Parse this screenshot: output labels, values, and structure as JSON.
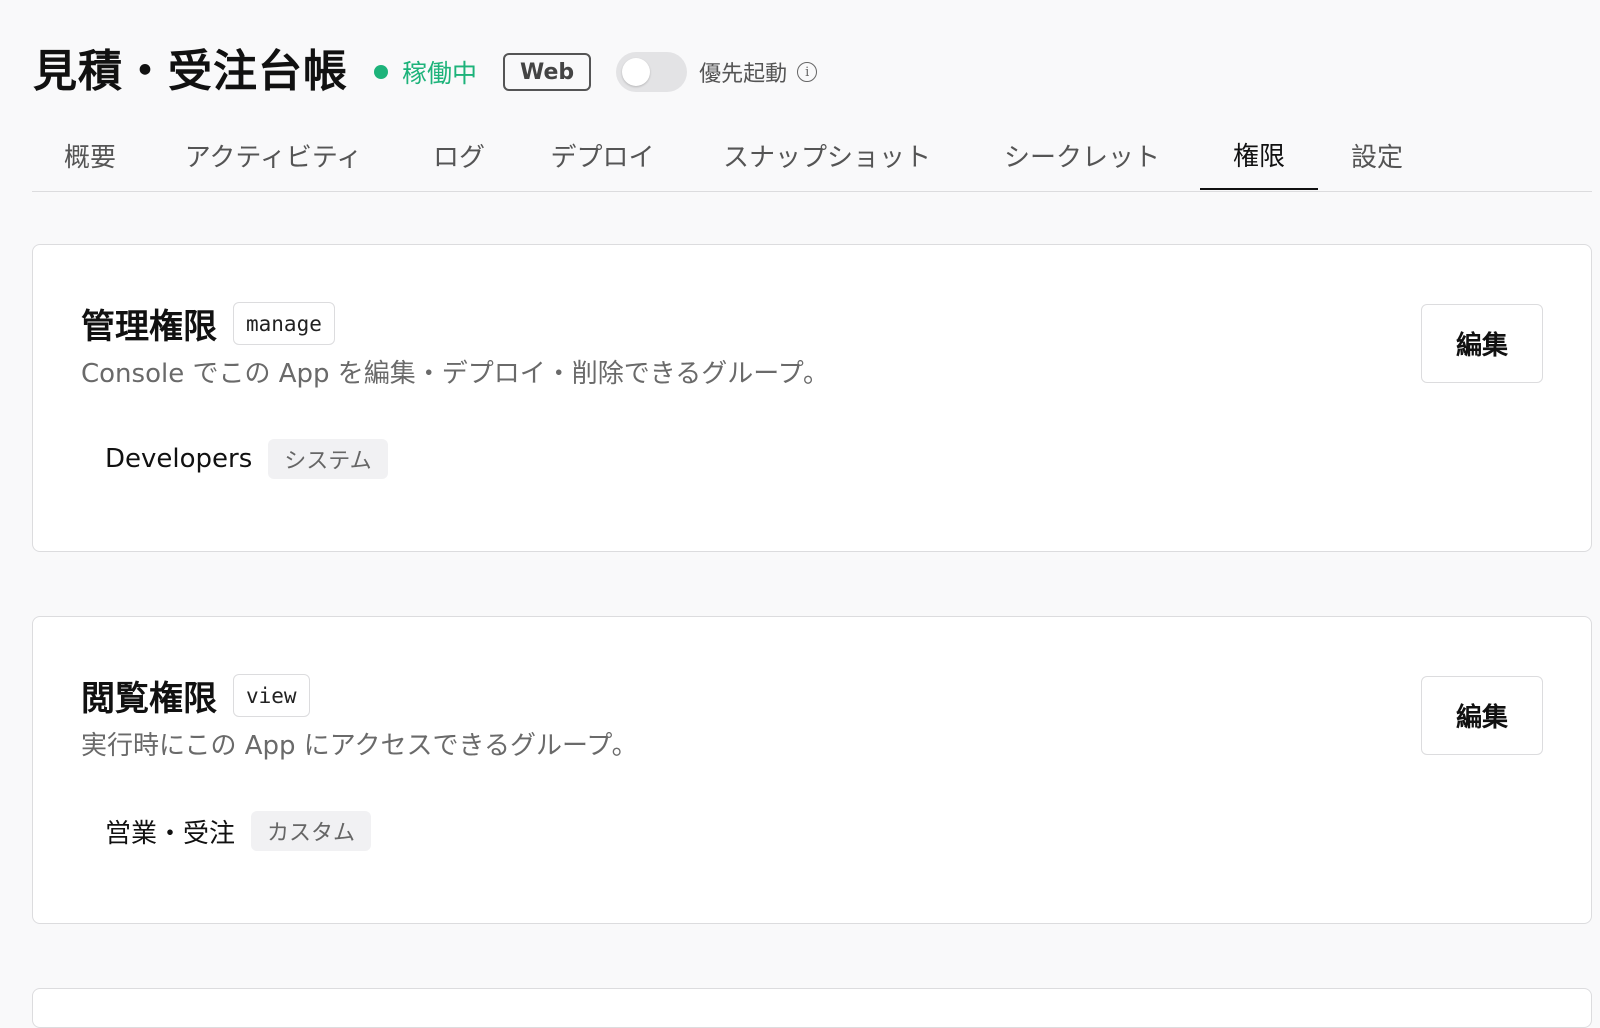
{
  "header": {
    "title": "見積・受注台帳",
    "status": "稼働中",
    "type_badge": "Web",
    "toggle_label": "優先起動",
    "toggle_on": false,
    "info_glyph": "i"
  },
  "tabs": [
    {
      "label": "概要"
    },
    {
      "label": "アクティビティ"
    },
    {
      "label": "ログ"
    },
    {
      "label": "デプロイ"
    },
    {
      "label": "スナップショット"
    },
    {
      "label": "シークレット"
    },
    {
      "label": "権限",
      "active": true
    },
    {
      "label": "設定"
    }
  ],
  "permissions": [
    {
      "title": "管理権限",
      "code": "manage",
      "description": "Console でこの App を編集・デプロイ・削除できるグループ。",
      "group": {
        "name": "Developers",
        "tag": "システム"
      },
      "edit_label": "編集"
    },
    {
      "title": "閲覧権限",
      "code": "view",
      "description": "実行時にこの App にアクセスできるグループ。",
      "group": {
        "name": "営業・受注",
        "tag": "カスタム"
      },
      "edit_label": "編集"
    }
  ],
  "colors": {
    "status": "#1db37a",
    "background": "#f9f9fa",
    "border": "#dcdcde"
  },
  "icons": {
    "status": "status-dot-icon",
    "info": "info-icon"
  }
}
